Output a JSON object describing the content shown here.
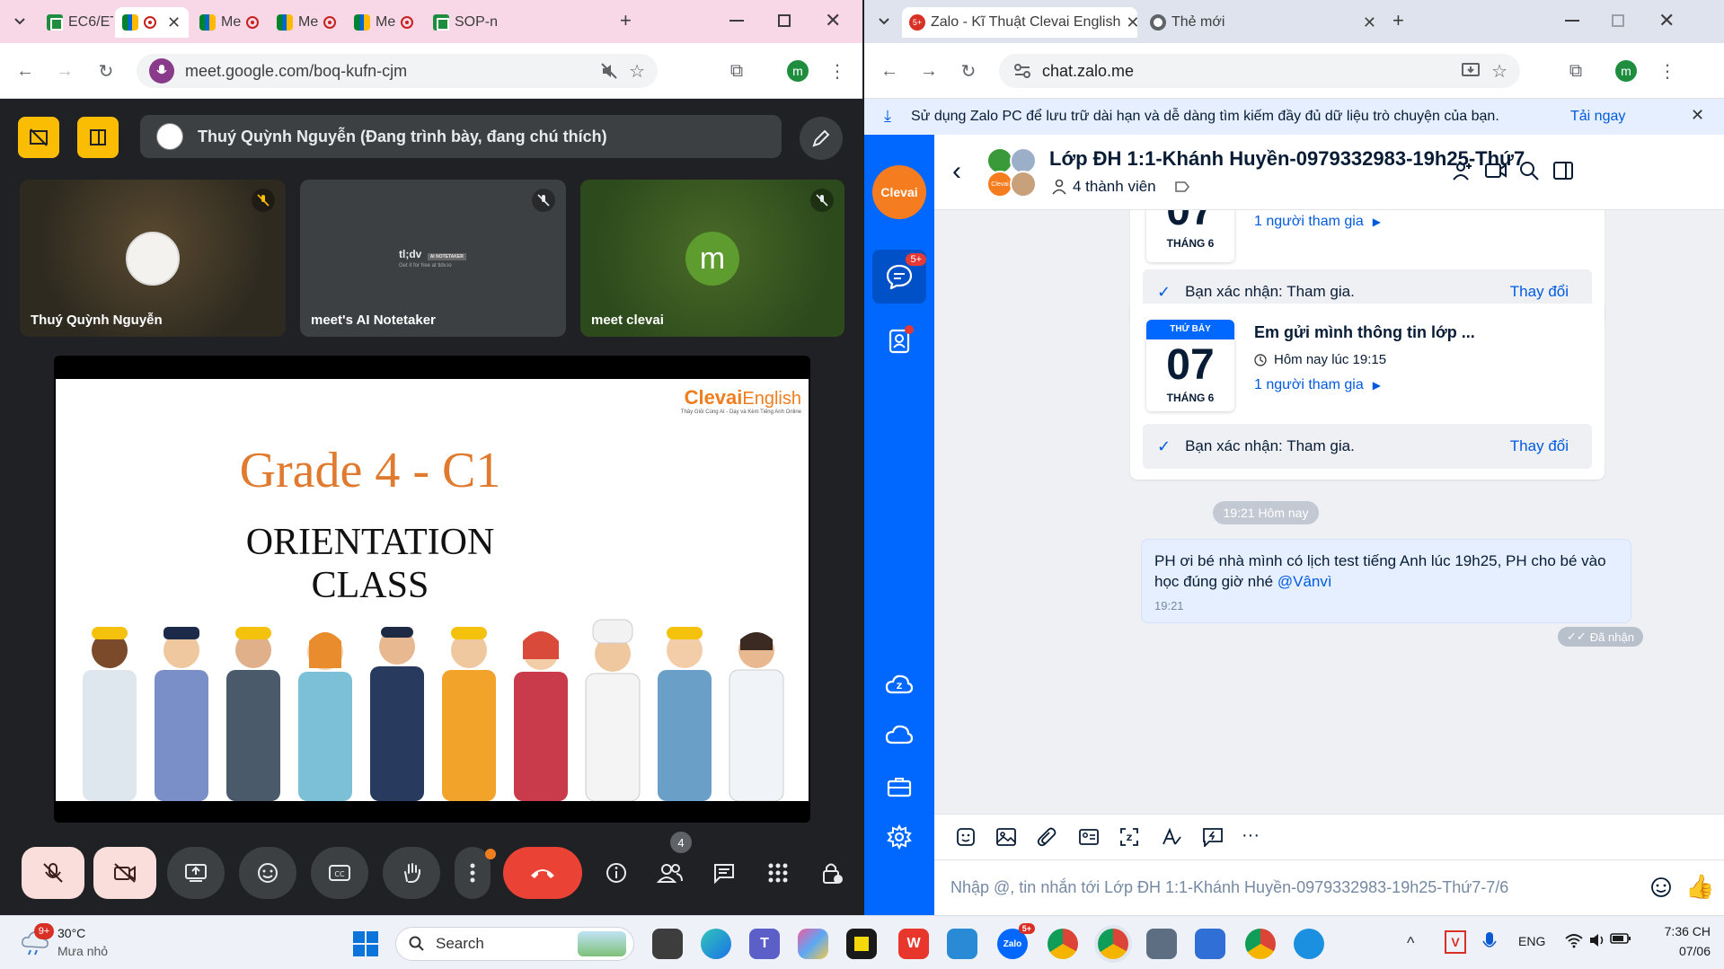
{
  "left_browser": {
    "tabs": [
      {
        "label": "EC6/ET",
        "icon": "sheets-icon"
      },
      {
        "label": "",
        "icon": "meet-icon",
        "recording": true
      },
      {
        "label": "Me",
        "icon": "meet-icon",
        "recording": true
      },
      {
        "label": "Me",
        "icon": "meet-icon",
        "recording": true
      },
      {
        "label": "Me",
        "icon": "meet-icon",
        "recording": true
      },
      {
        "label": "SOP-n",
        "icon": "sheets-icon"
      }
    ],
    "url": "meet.google.com/boq-kufn-cjm",
    "profile_initial": "m"
  },
  "meet": {
    "presenter_text": "Thuý Quỳnh Nguyễn (Đang trình bày, đang chú thích)",
    "tiles": [
      {
        "name": "Thuý Quỳnh Nguyễn"
      },
      {
        "name": "meet's AI Notetaker",
        "brand": "tl;dv",
        "brand_badge": "AI NOTETAKER",
        "brand_sub": "Get it for free at tldv.io"
      },
      {
        "name": "meet clevai",
        "initial": "m"
      }
    ],
    "slide": {
      "logo_main": "Clevai",
      "logo_accent": "English",
      "logo_tagline": "Thầy Giỏi Cùng AI - Dạy và Kèm Tiếng Anh Online",
      "title": "Grade 4 - C1",
      "subtitle_line1": "ORIENTATION",
      "subtitle_line2": "CLASS"
    },
    "participants_count": "4"
  },
  "right_browser": {
    "tabs": [
      {
        "label": "Zalo - Kĩ Thuật Clevai English",
        "badge": "5+"
      },
      {
        "label": "Thẻ mới"
      }
    ],
    "url": "chat.zalo.me",
    "profile_initial": "m"
  },
  "zalo": {
    "banner_text": "Sử dụng Zalo PC để lưu trữ dài hạn và dễ dàng tìm kiếm đầy đủ dữ liệu trò chuyện của bạn.",
    "banner_link": "Tải ngay",
    "nav_logo": "Clevai",
    "nav_badge": "5+",
    "chat_title": "Lớp ĐH 1:1-Khánh Huyền-0979332983-19h25-Thứ7",
    "member_count": "4 thành viên",
    "avatar_group_label": "Clevai",
    "card1": {
      "day": "07",
      "month": "THÁNG 6",
      "participants": "1 người tham gia",
      "confirm": "Bạn xác nhận: Tham gia.",
      "change": "Thay đổi"
    },
    "card2": {
      "weekday": "THỨ BẢY",
      "day": "07",
      "month": "THÁNG 6",
      "title": "Em gửi mình thông tin lớp ...",
      "time": "Hôm nay lúc 19:15",
      "participants": "1 người tham gia",
      "confirm": "Bạn xác nhận: Tham gia.",
      "change": "Thay đổi"
    },
    "time_divider": "19:21 Hôm nay",
    "message": {
      "text": "PH ơi bé nhà mình có lịch test tiếng Anh lúc 19h25, PH cho bé vào học đúng giờ nhé",
      "mention": "@Vânvì",
      "time": "19:21",
      "status": "Đã nhận"
    },
    "input_placeholder": "Nhập @, tin nhắn tới Lớp ĐH 1:1-Khánh Huyền-0979332983-19h25-Thứ7-7/6"
  },
  "taskbar": {
    "weather_temp": "30°C",
    "weather_desc": "Mưa nhỏ",
    "weather_badge": "9+",
    "search_label": "Search",
    "zalo_badge": "5+",
    "lang": "ENG",
    "time": "7:36 CH",
    "date": "07/06"
  },
  "colors": {
    "meet_bg": "#202124",
    "meet_yellow": "#fbbc04",
    "end_call_red": "#ea4335",
    "zalo_blue": "#0068ff",
    "clevai_orange": "#f07d1e",
    "link_blue": "#005ae0"
  }
}
